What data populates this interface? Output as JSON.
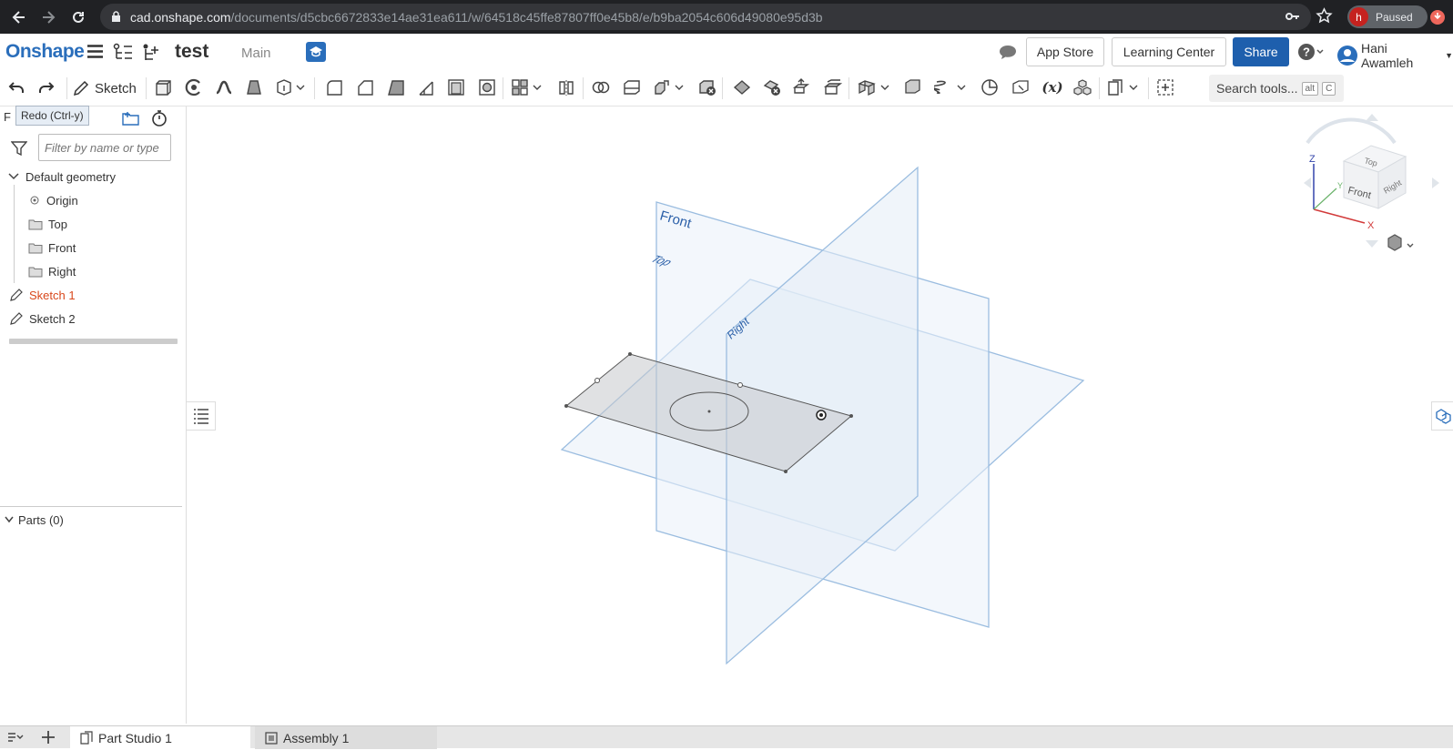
{
  "browser": {
    "url_host": "cad.onshape.com",
    "url_path": "/documents/d5cbc6672833e14ae31ea611/w/64518c45ffe87807ff0e45b8/e/b9ba2054c606d49080e95d3b",
    "profile_initial": "h",
    "profile_status": "Paused"
  },
  "header": {
    "logo": "Onshape",
    "document_title": "test",
    "branch": "Main",
    "app_store": "App Store",
    "learning_center": "Learning Center",
    "share": "Share",
    "user_name": "Hani Awamleh"
  },
  "toolbar": {
    "sketch_label": "Sketch",
    "search_label": "Search tools...",
    "search_key1": "alt",
    "search_key2": "C",
    "tooltip": "Redo (Ctrl-y)"
  },
  "feature_panel": {
    "title_fragment": "F",
    "filter_placeholder": "Filter by name or type",
    "default_geometry": "Default geometry",
    "origin": "Origin",
    "planes": [
      "Top",
      "Front",
      "Right"
    ],
    "sketches": [
      "Sketch 1",
      "Sketch 2"
    ],
    "parts": "Parts (0)"
  },
  "viewport": {
    "plane_labels": {
      "front": "Front",
      "top": "Top",
      "right": "Right"
    },
    "view_cube": {
      "top": "Top",
      "front": "Front",
      "right": "Right",
      "axis_x": "X",
      "axis_y": "Y",
      "axis_z": "Z"
    }
  },
  "tabs": [
    "Part Studio 1",
    "Assembly 1"
  ],
  "colors": {
    "brand_blue": "#2a6ebb",
    "share_blue": "#1e5fad",
    "sketch_active": "#d9481c",
    "plane_stroke": "#9bbde0",
    "plane_label": "#2a5fa8"
  }
}
